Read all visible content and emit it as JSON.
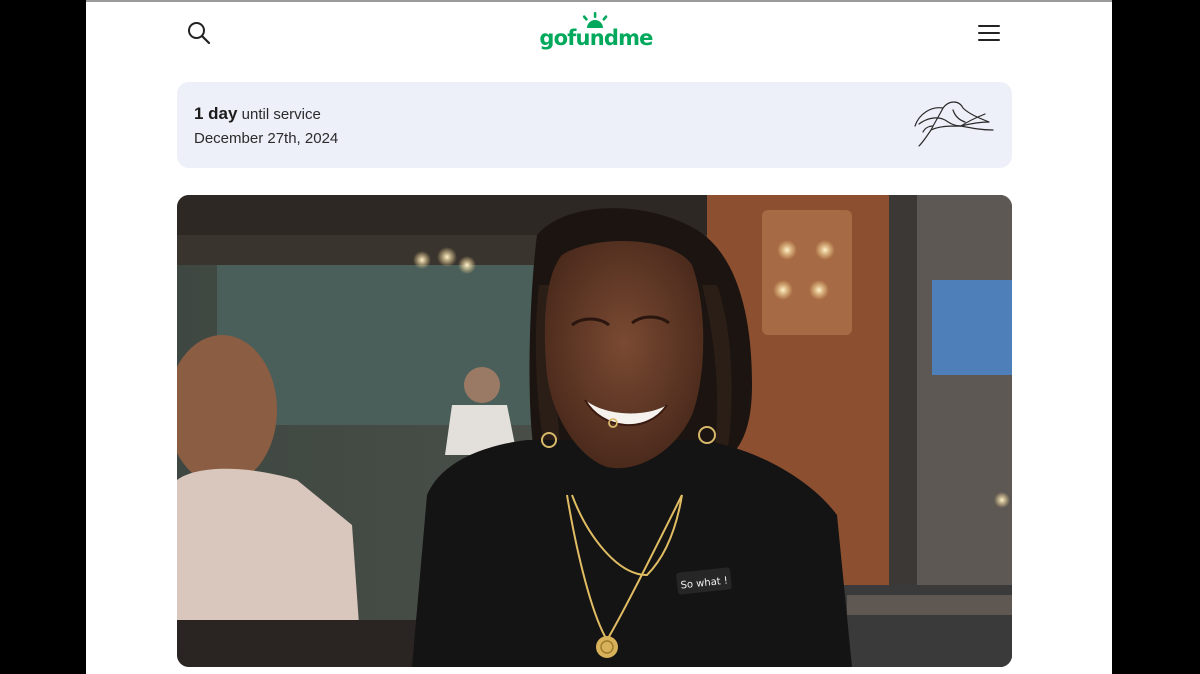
{
  "header": {
    "logo_text": "gofundme",
    "search_icon": "search-icon",
    "menu_icon": "hamburger-menu-icon",
    "brand_color": "#02a95c"
  },
  "service": {
    "countdown_strong": "1 day",
    "countdown_rest": " until service",
    "date": "December 27th, 2024",
    "illustration_icon": "calla-lily-icon"
  },
  "photo": {
    "shirt_text": "So what !",
    "alt": "Smiling person in a black shirt"
  }
}
